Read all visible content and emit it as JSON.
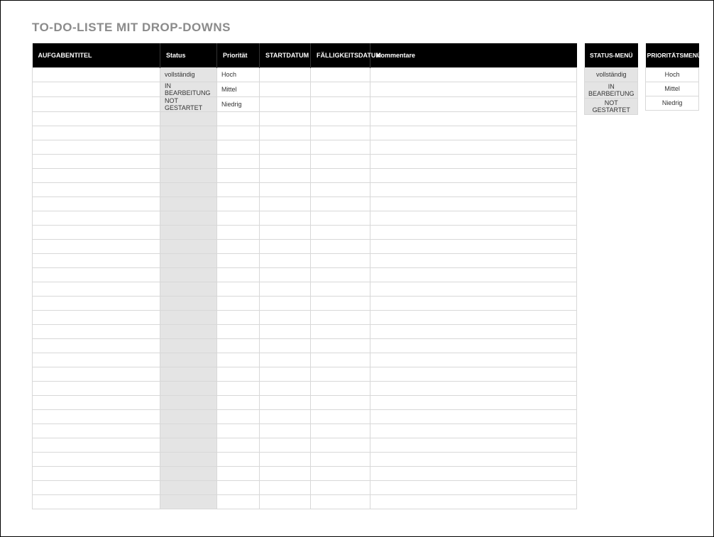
{
  "title": "TO-DO-LISTE MIT DROP-DOWNS",
  "columns": {
    "aufgabentitel": "AUFGABENTITEL",
    "status": "Status",
    "prioritaet": "Priorität",
    "startdatum": "STARTDATUM",
    "faelligkeitsdatum": "FÄLLIGKEITSDATUM",
    "kommentare": "Kommentare"
  },
  "rows": [
    {
      "aufgabentitel": "",
      "status": "vollständig",
      "prioritaet": "Hoch",
      "startdatum": "",
      "faelligkeitsdatum": "",
      "kommentare": ""
    },
    {
      "aufgabentitel": "",
      "status": "IN BEARBEITUNG",
      "prioritaet": "Mittel",
      "startdatum": "",
      "faelligkeitsdatum": "",
      "kommentare": ""
    },
    {
      "aufgabentitel": "",
      "status": "NOT GESTARTET",
      "prioritaet": "Niedrig",
      "startdatum": "",
      "faelligkeitsdatum": "",
      "kommentare": ""
    },
    {
      "aufgabentitel": "",
      "status": "",
      "prioritaet": "",
      "startdatum": "",
      "faelligkeitsdatum": "",
      "kommentare": ""
    },
    {
      "aufgabentitel": "",
      "status": "",
      "prioritaet": "",
      "startdatum": "",
      "faelligkeitsdatum": "",
      "kommentare": ""
    },
    {
      "aufgabentitel": "",
      "status": "",
      "prioritaet": "",
      "startdatum": "",
      "faelligkeitsdatum": "",
      "kommentare": ""
    },
    {
      "aufgabentitel": "",
      "status": "",
      "prioritaet": "",
      "startdatum": "",
      "faelligkeitsdatum": "",
      "kommentare": ""
    },
    {
      "aufgabentitel": "",
      "status": "",
      "prioritaet": "",
      "startdatum": "",
      "faelligkeitsdatum": "",
      "kommentare": ""
    },
    {
      "aufgabentitel": "",
      "status": "",
      "prioritaet": "",
      "startdatum": "",
      "faelligkeitsdatum": "",
      "kommentare": ""
    },
    {
      "aufgabentitel": "",
      "status": "",
      "prioritaet": "",
      "startdatum": "",
      "faelligkeitsdatum": "",
      "kommentare": ""
    },
    {
      "aufgabentitel": "",
      "status": "",
      "prioritaet": "",
      "startdatum": "",
      "faelligkeitsdatum": "",
      "kommentare": ""
    },
    {
      "aufgabentitel": "",
      "status": "",
      "prioritaet": "",
      "startdatum": "",
      "faelligkeitsdatum": "",
      "kommentare": ""
    },
    {
      "aufgabentitel": "",
      "status": "",
      "prioritaet": "",
      "startdatum": "",
      "faelligkeitsdatum": "",
      "kommentare": ""
    },
    {
      "aufgabentitel": "",
      "status": "",
      "prioritaet": "",
      "startdatum": "",
      "faelligkeitsdatum": "",
      "kommentare": ""
    },
    {
      "aufgabentitel": "",
      "status": "",
      "prioritaet": "",
      "startdatum": "",
      "faelligkeitsdatum": "",
      "kommentare": ""
    },
    {
      "aufgabentitel": "",
      "status": "",
      "prioritaet": "",
      "startdatum": "",
      "faelligkeitsdatum": "",
      "kommentare": ""
    },
    {
      "aufgabentitel": "",
      "status": "",
      "prioritaet": "",
      "startdatum": "",
      "faelligkeitsdatum": "",
      "kommentare": ""
    },
    {
      "aufgabentitel": "",
      "status": "",
      "prioritaet": "",
      "startdatum": "",
      "faelligkeitsdatum": "",
      "kommentare": ""
    },
    {
      "aufgabentitel": "",
      "status": "",
      "prioritaet": "",
      "startdatum": "",
      "faelligkeitsdatum": "",
      "kommentare": ""
    },
    {
      "aufgabentitel": "",
      "status": "",
      "prioritaet": "",
      "startdatum": "",
      "faelligkeitsdatum": "",
      "kommentare": ""
    },
    {
      "aufgabentitel": "",
      "status": "",
      "prioritaet": "",
      "startdatum": "",
      "faelligkeitsdatum": "",
      "kommentare": ""
    },
    {
      "aufgabentitel": "",
      "status": "",
      "prioritaet": "",
      "startdatum": "",
      "faelligkeitsdatum": "",
      "kommentare": ""
    },
    {
      "aufgabentitel": "",
      "status": "",
      "prioritaet": "",
      "startdatum": "",
      "faelligkeitsdatum": "",
      "kommentare": ""
    },
    {
      "aufgabentitel": "",
      "status": "",
      "prioritaet": "",
      "startdatum": "",
      "faelligkeitsdatum": "",
      "kommentare": ""
    },
    {
      "aufgabentitel": "",
      "status": "",
      "prioritaet": "",
      "startdatum": "",
      "faelligkeitsdatum": "",
      "kommentare": ""
    },
    {
      "aufgabentitel": "",
      "status": "",
      "prioritaet": "",
      "startdatum": "",
      "faelligkeitsdatum": "",
      "kommentare": ""
    },
    {
      "aufgabentitel": "",
      "status": "",
      "prioritaet": "",
      "startdatum": "",
      "faelligkeitsdatum": "",
      "kommentare": ""
    },
    {
      "aufgabentitel": "",
      "status": "",
      "prioritaet": "",
      "startdatum": "",
      "faelligkeitsdatum": "",
      "kommentare": ""
    },
    {
      "aufgabentitel": "",
      "status": "",
      "prioritaet": "",
      "startdatum": "",
      "faelligkeitsdatum": "",
      "kommentare": ""
    },
    {
      "aufgabentitel": "",
      "status": "",
      "prioritaet": "",
      "startdatum": "",
      "faelligkeitsdatum": "",
      "kommentare": ""
    },
    {
      "aufgabentitel": "",
      "status": "",
      "prioritaet": "",
      "startdatum": "",
      "faelligkeitsdatum": "",
      "kommentare": ""
    }
  ],
  "status_menu": {
    "header": "STATUS-MENÜ",
    "items": [
      "vollständig",
      "IN BEARBEITUNG",
      "NOT GESTARTET"
    ]
  },
  "priority_menu": {
    "header": "PRIORITÄTSMENÜ",
    "items": [
      "Hoch",
      "Mittel",
      "Niedrig"
    ]
  }
}
